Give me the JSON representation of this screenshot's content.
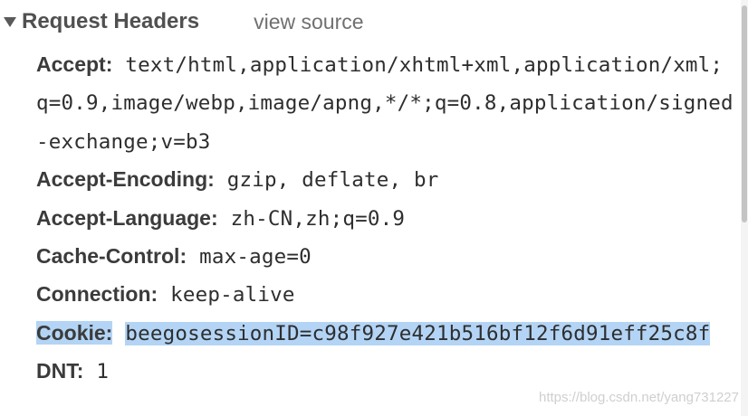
{
  "section": {
    "title": "Request Headers",
    "view_source": "view source"
  },
  "headers": [
    {
      "name": "Accept:",
      "value": "text/html,application/xhtml+xml,application/xml;q=0.9,image/webp,image/apng,*/*;q=0.8,application/signed-exchange;v=b3"
    },
    {
      "name": "Accept-Encoding:",
      "value": "gzip, deflate, br"
    },
    {
      "name": "Accept-Language:",
      "value": "zh-CN,zh;q=0.9"
    },
    {
      "name": "Cache-Control:",
      "value": "max-age=0"
    },
    {
      "name": "Connection:",
      "value": "keep-alive"
    },
    {
      "name": "Cookie:",
      "value": "beegosessionID=c98f927e421b516bf12f6d91eff25c8f"
    },
    {
      "name": "DNT:",
      "value": "1"
    }
  ],
  "watermark": "https://blog.csdn.net/yang731227",
  "colors": {
    "selection": "#b3d4f5"
  }
}
